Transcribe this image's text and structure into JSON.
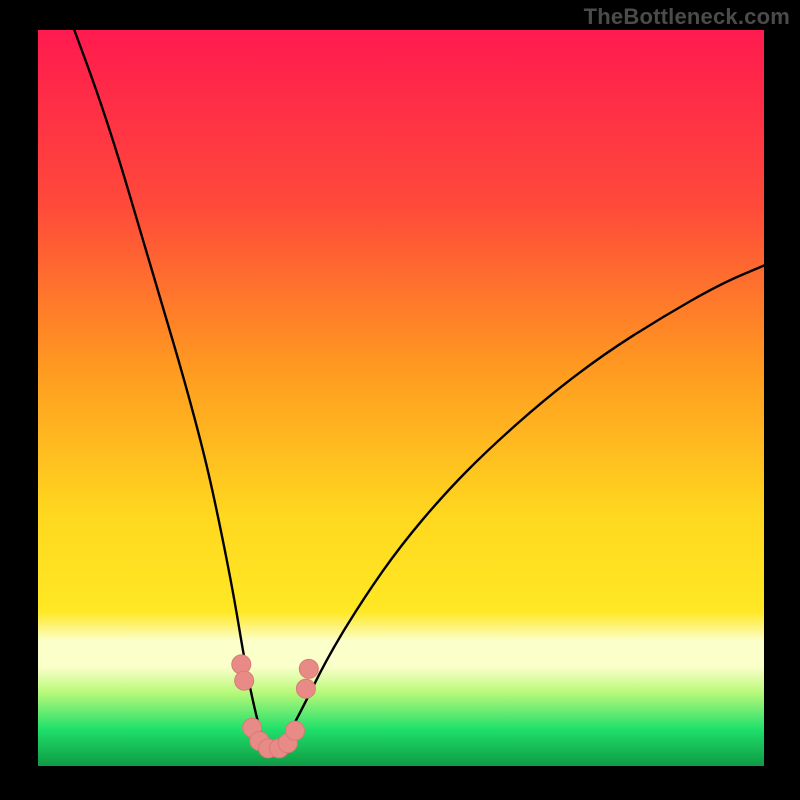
{
  "watermark": "TheBottleneck.com",
  "colors": {
    "bg_black": "#000000",
    "curve": "#000000",
    "marker_fill": "#e88b87",
    "marker_stroke": "#d97a77",
    "gradient_top": "#ff1a4f",
    "gradient_mid_upper": "#ff7a22",
    "gradient_mid": "#ffe824",
    "gradient_band_light": "#fbffc9",
    "gradient_green": "#1fe06a",
    "gradient_bottom": "#0d8f3f"
  },
  "chart_data": {
    "type": "line",
    "title": "",
    "xlabel": "",
    "ylabel": "",
    "xlim": [
      0,
      100
    ],
    "ylim": [
      0,
      100
    ],
    "grid": false,
    "legend": false,
    "series": [
      {
        "name": "bottleneck_curve",
        "x": [
          5,
          8,
          11,
          14,
          17,
          20,
          23,
          25,
          27,
          28.5,
          30,
          31,
          32,
          33,
          34,
          36,
          40,
          45,
          50,
          56,
          62,
          70,
          78,
          86,
          94,
          100
        ],
        "y": [
          100,
          92,
          83,
          73,
          63,
          53,
          42,
          33,
          23,
          14,
          7,
          3.5,
          2,
          2,
          3.5,
          7,
          15,
          23,
          30,
          37,
          43,
          50,
          56,
          61,
          65.5,
          68
        ]
      }
    ],
    "markers": [
      {
        "x": 28.0,
        "y": 13.8
      },
      {
        "x": 28.4,
        "y": 11.6
      },
      {
        "x": 29.5,
        "y": 5.2
      },
      {
        "x": 30.5,
        "y": 3.4
      },
      {
        "x": 31.7,
        "y": 2.4
      },
      {
        "x": 33.2,
        "y": 2.4
      },
      {
        "x": 34.4,
        "y": 3.1
      },
      {
        "x": 35.4,
        "y": 4.8
      },
      {
        "x": 36.9,
        "y": 10.5
      },
      {
        "x": 37.3,
        "y": 13.2
      }
    ],
    "background_gradient_stops": [
      {
        "pct": 0,
        "note": "top (warm red)"
      },
      {
        "pct": 50,
        "note": "orange→yellow"
      },
      {
        "pct": 82,
        "note": "pale yellow band"
      },
      {
        "pct": 95,
        "note": "green"
      },
      {
        "pct": 100,
        "note": "dark green"
      }
    ]
  }
}
